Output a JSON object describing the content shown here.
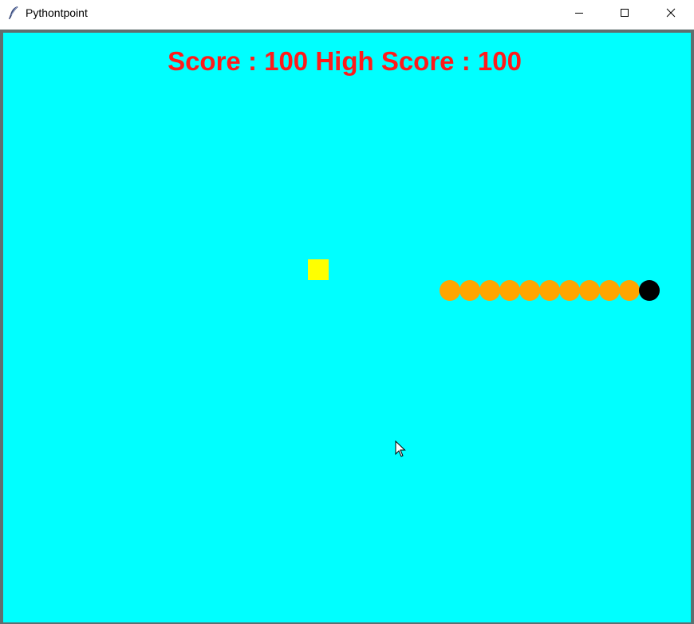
{
  "window": {
    "title": "Pythontpoint",
    "icon": "feather-icon",
    "buttons": {
      "minimize": "minimize-icon",
      "maximize": "maximize-icon",
      "close": "close-icon"
    }
  },
  "game": {
    "score_label": "Score : 100 High Score : 100",
    "score": 100,
    "high_score": 100,
    "background_color": "#00ffff",
    "score_color": "#ff1a1a",
    "food": {
      "color": "#ffff00",
      "shape": "square"
    },
    "snake": {
      "head_color": "#000000",
      "body_color": "#ffa500",
      "direction": "right",
      "body_segments": 10
    }
  }
}
